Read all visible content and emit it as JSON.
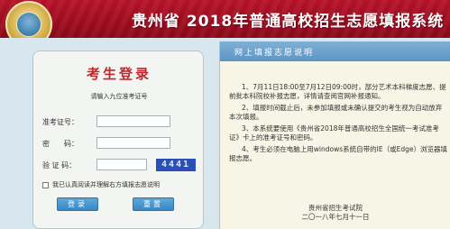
{
  "header": {
    "title": "贵州省 2018年普通高校招生志愿填报系统"
  },
  "login": {
    "title": "考生登录",
    "subtitle": "请输入九位准考证号",
    "fields": {
      "exam_no_label": "准考证号：",
      "password_label": "密　　码：",
      "captcha_label": "验 证 码：",
      "exam_no_value": "",
      "password_value": "",
      "captcha_value": ""
    },
    "captcha_code": "4441",
    "agree_text": "我已认真阅读并理解右方填报志愿说明",
    "login_button": "登录",
    "reset_button": "重置"
  },
  "notice": {
    "title": "网上填报志愿说明",
    "items": [
      "1、7月11日18:00至7月12日09:00时，部分艺术本科梯度志愿、提前批本科院校补报志愿，详情请查阅官网补报通知。",
      "2、填报时间截止后，未参加填报或未确认提交的考生视为自动放弃本次填报。",
      "3、本系统要使用《贵州省2018年普通高校招生全国统一考试准考证》卡上的准考证号和密码。",
      "4、考生必须在电脑上用windows系统自带的IE（或Edge）浏览器填报志愿。"
    ],
    "signature": "贵州省招生考试院",
    "date": "二〇一八年七月十一日"
  },
  "colors": {
    "header_bg": "#a80f23",
    "login_title": "#c0282d",
    "button_bg": "#3a86c2",
    "notice_head_bg": "#5c95c3",
    "captcha_bg": "#2b4fb8"
  }
}
